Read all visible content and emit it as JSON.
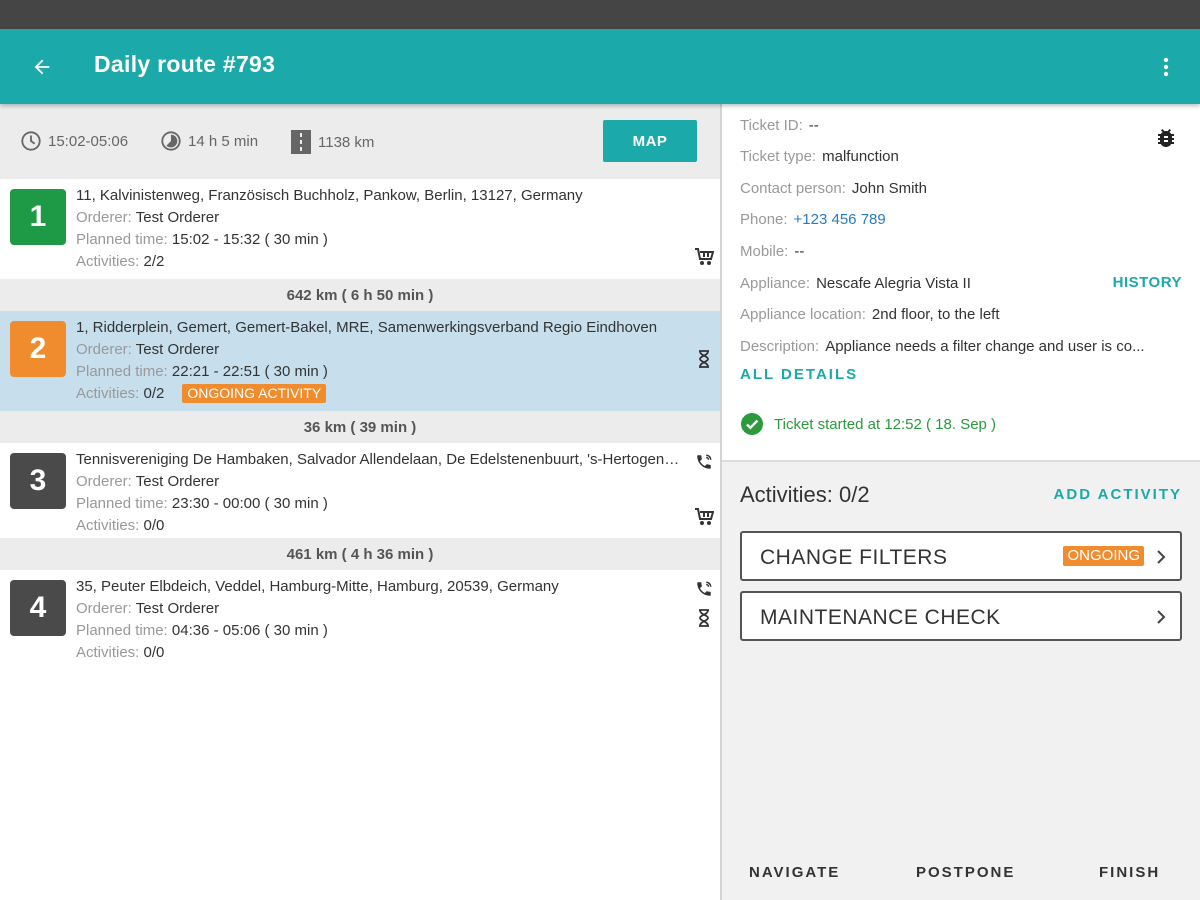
{
  "appbar": {
    "title": "Daily route #793"
  },
  "summary": {
    "time_range": "15:02-05:06",
    "duration": "14 h 5 min",
    "distance": "1138 km",
    "map_label": "MAP"
  },
  "stops": [
    {
      "number": "1",
      "color": "#1e9a46",
      "address": "11, Kalvinistenweg, Französisch Buchholz, Pankow, Berlin, 13127, Germany",
      "orderer_label": "Orderer:",
      "orderer": "Test Orderer",
      "planned_label": "Planned time:",
      "planned": "15:02 - 15:32 ( 30 min )",
      "activities_label": "Activities:",
      "activities": "2/2"
    },
    {
      "number": "2",
      "color": "#f08c2e",
      "address": "1, Ridderplein, Gemert, Gemert-Bakel, MRE, Samenwerkingsverband Regio Eindhoven",
      "orderer_label": "Orderer:",
      "orderer": "Test Orderer",
      "planned_label": "Planned time:",
      "planned": "22:21 - 22:51 ( 30 min )",
      "activities_label": "Activities:",
      "activities": "0/2",
      "tag": "ONGOING ACTIVITY"
    },
    {
      "number": "3",
      "color": "#4a4a4a",
      "address": "Tennisvereniging De Hambaken, Salvador Allendelaan, De Edelstenenbuurt, 's-Hertogenbosch",
      "orderer_label": "Orderer:",
      "orderer": "Test Orderer",
      "planned_label": "Planned time:",
      "planned": "23:30 - 00:00 ( 30 min )",
      "activities_label": "Activities:",
      "activities": "0/0"
    },
    {
      "number": "4",
      "color": "#4a4a4a",
      "address": "35, Peuter Elbdeich, Veddel, Hamburg-Mitte, Hamburg, 20539, Germany",
      "orderer_label": "Orderer:",
      "orderer": "Test Orderer",
      "planned_label": "Planned time:",
      "planned": "04:36 - 05:06 ( 30 min )",
      "activities_label": "Activities:",
      "activities": "0/0"
    }
  ],
  "distances": [
    "642 km ( 6 h 50 min )",
    "36 km ( 39 min )",
    "461 km ( 4 h 36 min )"
  ],
  "ticket": {
    "id_label": "Ticket ID:",
    "id": "--",
    "type_label": "Ticket type:",
    "type": "malfunction",
    "contact_label": "Contact person:",
    "contact": "John Smith",
    "phone_label": "Phone:",
    "phone": "+123 456 789",
    "mobile_label": "Mobile:",
    "mobile": "--",
    "appliance_label": "Appliance:",
    "appliance": "Nescafe Alegria Vista II",
    "history_label": "HISTORY",
    "location_label": "Appliance location:",
    "location": "2nd floor, to the left",
    "description_label": "Description:",
    "description": "Appliance needs a filter change and user is co...",
    "all_details_label": "ALL DETAILS",
    "started": "Ticket started at 12:52 ( 18. Sep )"
  },
  "activities": {
    "title": "Activities: 0/2",
    "add_label": "ADD ACTIVITY",
    "items": [
      {
        "name": "CHANGE FILTERS",
        "tag": "ONGOING"
      },
      {
        "name": "MAINTENANCE CHECK"
      }
    ]
  },
  "actions": {
    "navigate": "NAVIGATE",
    "postpone": "POSTPONE",
    "finish": "FINISH"
  },
  "colors": {
    "accent": "#1ba9a9",
    "ongoing": "#f08c2e",
    "done": "#1e9a46",
    "pending": "#4a4a4a"
  }
}
